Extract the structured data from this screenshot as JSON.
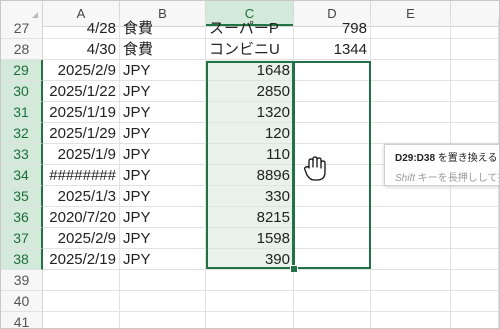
{
  "columns": [
    "A",
    "B",
    "C",
    "D",
    "E"
  ],
  "selected_column": "C",
  "rows": [
    {
      "num": "27",
      "a": "4/28",
      "b": "食費",
      "c": "スーパーP",
      "d": "798",
      "selected": false
    },
    {
      "num": "28",
      "a": "4/30",
      "b": "食費",
      "c": "コンビニU",
      "d": "1344",
      "selected": false
    },
    {
      "num": "29",
      "a": "2025/2/9",
      "b": "JPY",
      "c": "1648",
      "d": "",
      "selected": true
    },
    {
      "num": "30",
      "a": "2025/1/22",
      "b": "JPY",
      "c": "2850",
      "d": "",
      "selected": true
    },
    {
      "num": "31",
      "a": "2025/1/19",
      "b": "JPY",
      "c": "1320",
      "d": "",
      "selected": true
    },
    {
      "num": "32",
      "a": "2025/1/29",
      "b": "JPY",
      "c": "120",
      "d": "",
      "selected": true
    },
    {
      "num": "33",
      "a": "2025/1/9",
      "b": "JPY",
      "c": "110",
      "d": "",
      "selected": true
    },
    {
      "num": "34",
      "a": "########",
      "b": "JPY",
      "c": "8896",
      "d": "",
      "selected": true
    },
    {
      "num": "35",
      "a": "2025/1/3",
      "b": "JPY",
      "c": "330",
      "d": "",
      "selected": true
    },
    {
      "num": "36",
      "a": "2020/7/20",
      "b": "JPY",
      "c": "8215",
      "d": "",
      "selected": true
    },
    {
      "num": "37",
      "a": "2025/2/9",
      "b": "JPY",
      "c": "1598",
      "d": "",
      "selected": true
    },
    {
      "num": "38",
      "a": "2025/2/19",
      "b": "JPY",
      "c": "390",
      "d": "",
      "selected": true
    },
    {
      "num": "39",
      "a": "",
      "b": "",
      "c": "",
      "d": "",
      "selected": false
    },
    {
      "num": "40",
      "a": "",
      "b": "",
      "c": "",
      "d": "",
      "selected": false
    },
    {
      "num": "41",
      "a": "",
      "b": "",
      "c": "",
      "d": "",
      "selected": false
    }
  ],
  "tooltip": {
    "range": "D29:D38",
    "action": " を置き換える",
    "hint_key": "Shift",
    "hint_text": " キーを長押しして挿"
  },
  "colors": {
    "accent": "#217346",
    "selected_header_bg": "#d3e9da",
    "selected_cell_bg": "#e8f2ea"
  },
  "icons": {
    "cursor": "grab-hand-icon",
    "select_all": "select-all-triangle-icon"
  }
}
